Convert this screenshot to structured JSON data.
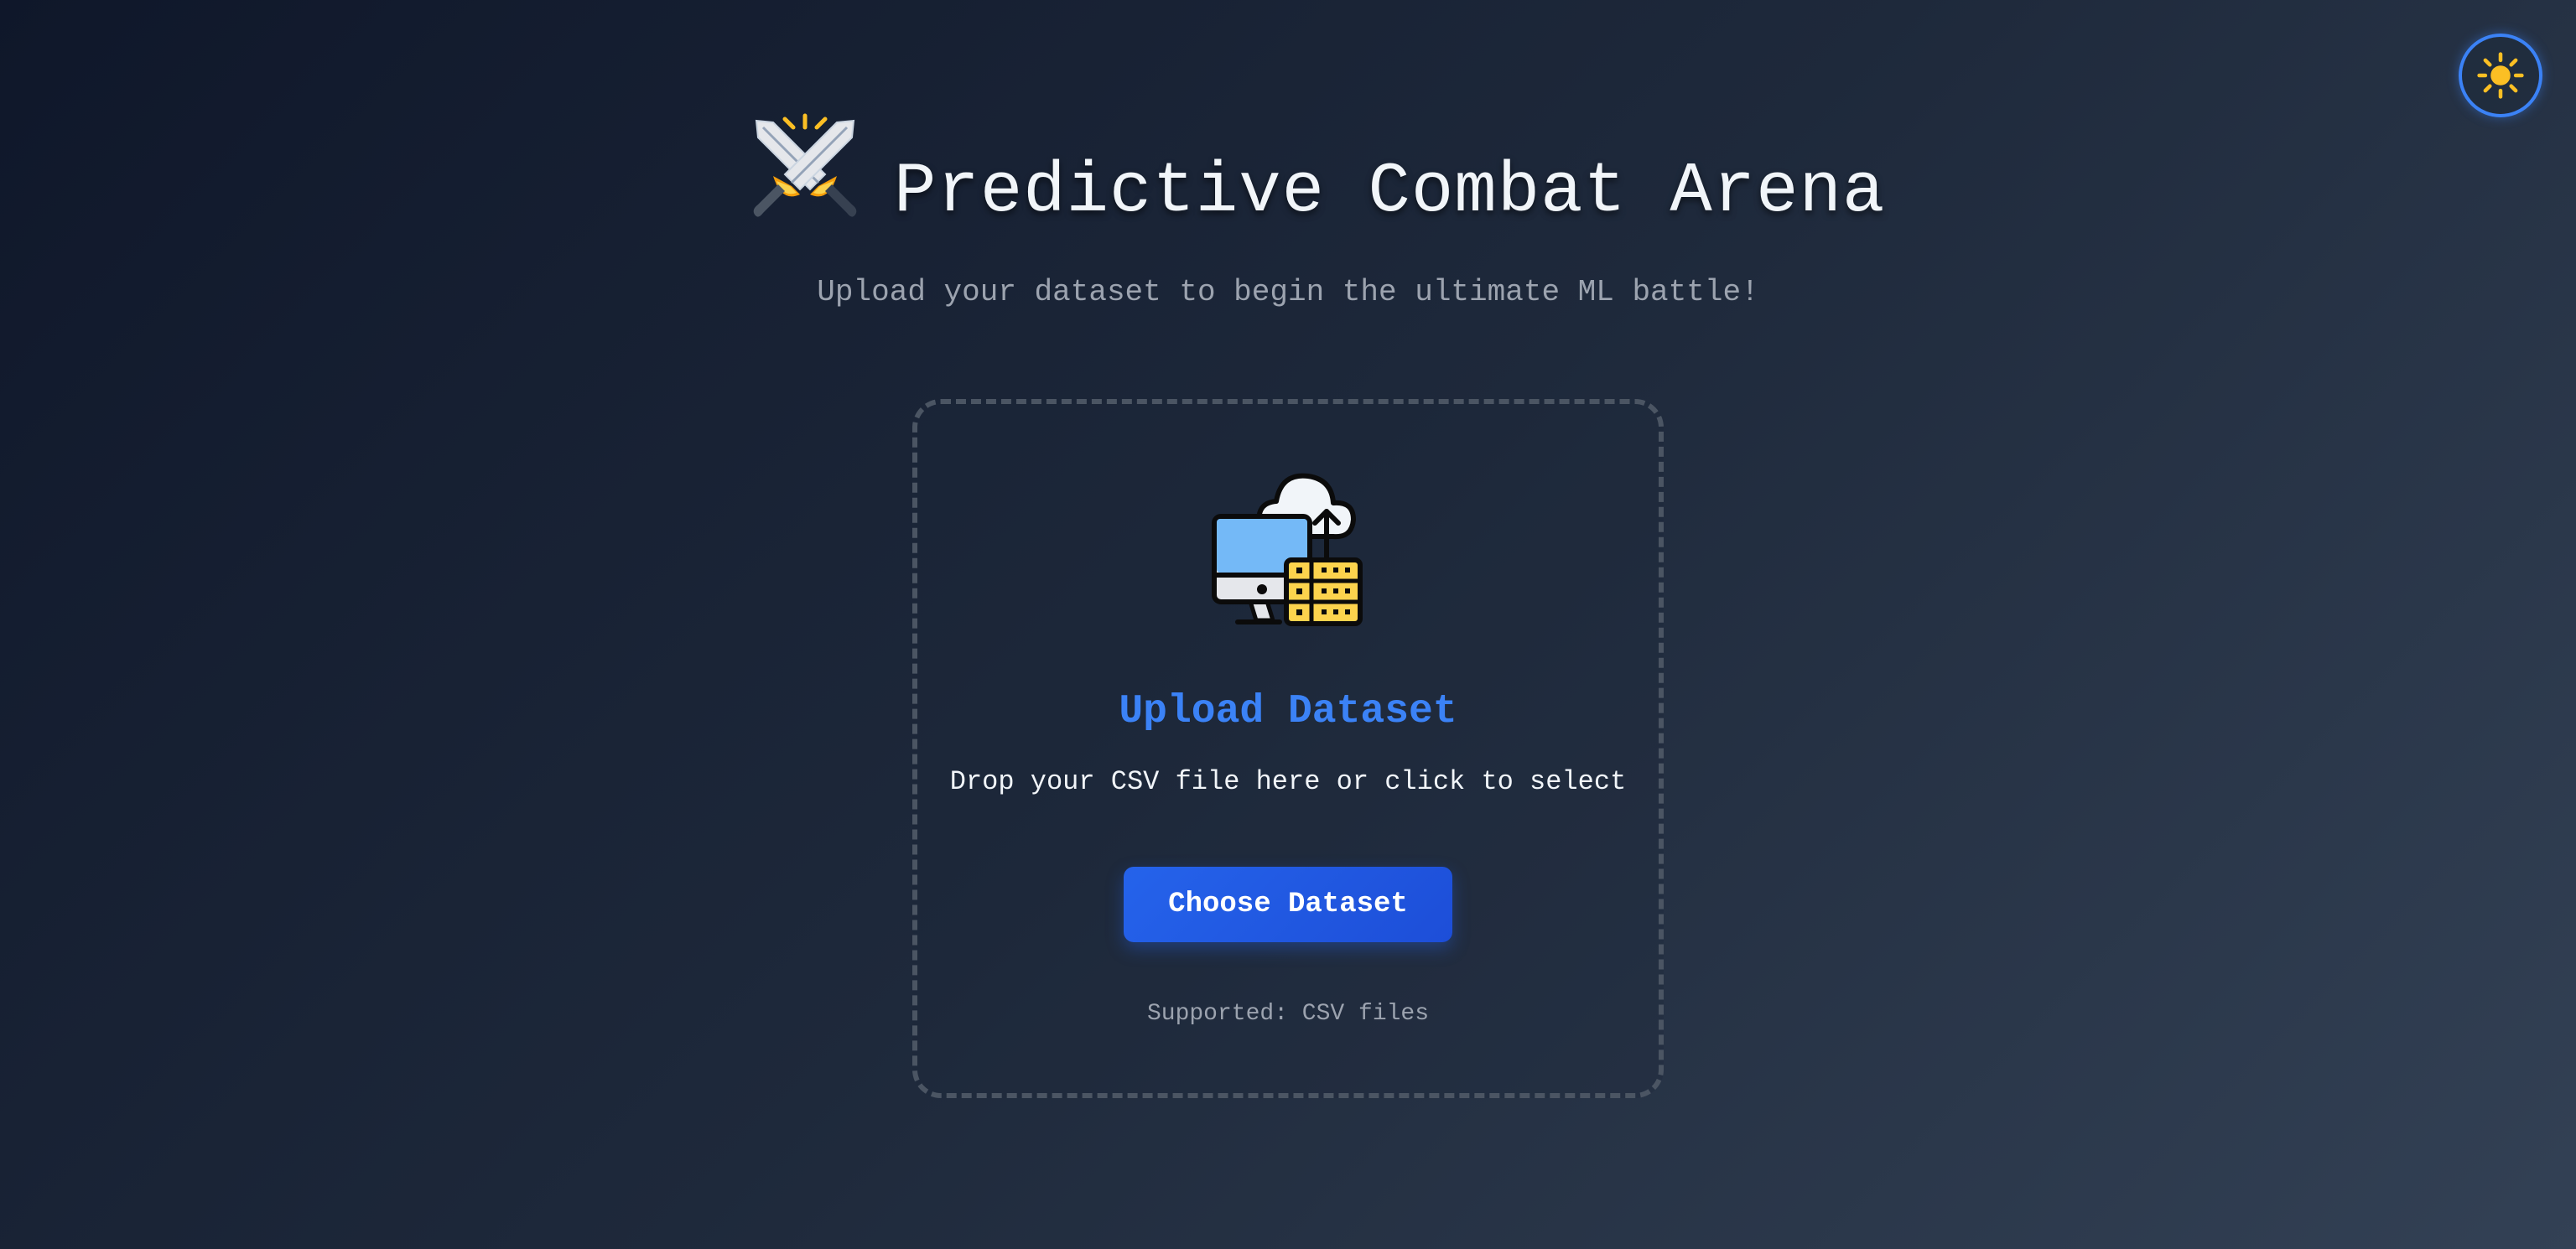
{
  "theme_toggle": {
    "icon": "sun-icon",
    "color": "#fbbf24"
  },
  "header": {
    "logo_icon": "crossed-swords-icon",
    "title": "Predictive Combat Arena",
    "subtitle": "Upload your dataset to begin the ultimate ML battle!"
  },
  "upload": {
    "illustration_icon": "upload-dataset-icon",
    "title": "Upload Dataset",
    "description": "Drop your CSV file here or click to select",
    "button_label": "Choose Dataset",
    "supported": "Supported: CSV files"
  },
  "colors": {
    "accent": "#3b82f6",
    "button": "#2563eb",
    "background_start": "#0f172a",
    "background_end": "#334155",
    "muted_text": "#9ca3af"
  }
}
